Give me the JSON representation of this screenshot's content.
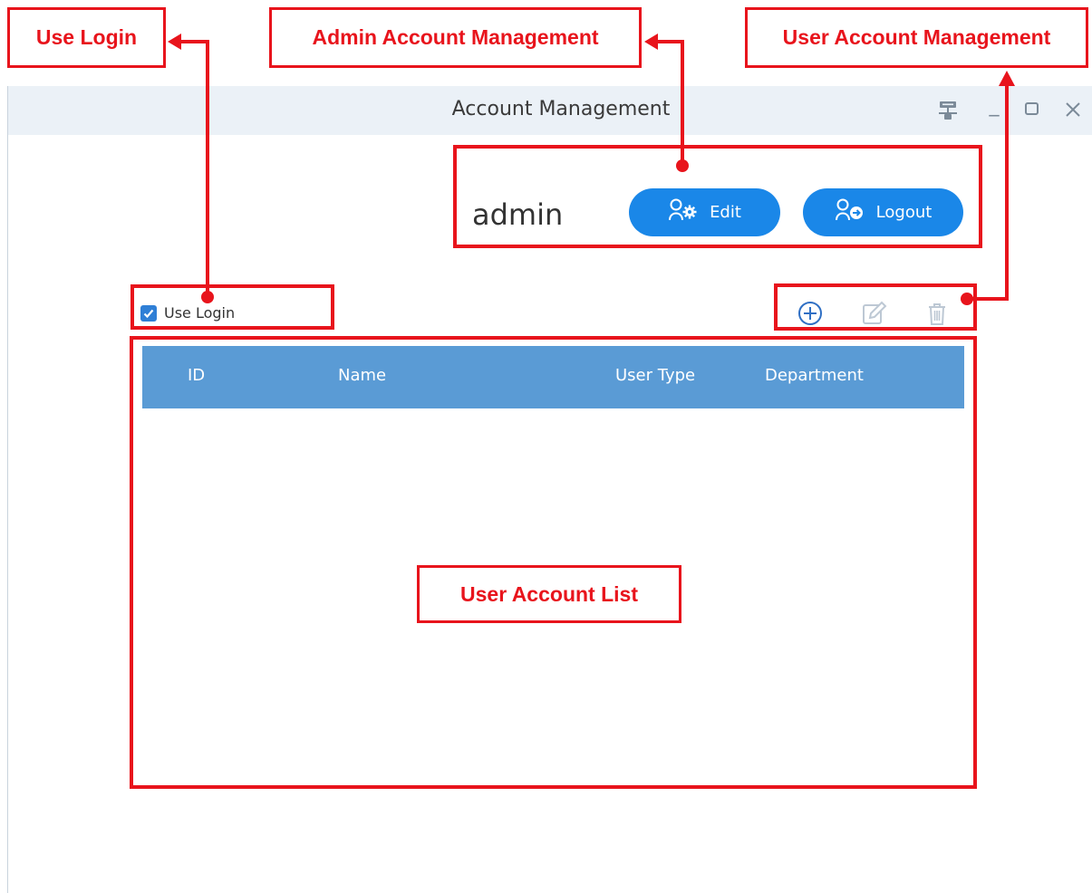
{
  "window": {
    "title": "Account Management",
    "minimize_glyph": "_",
    "controls": [
      "network-icon",
      "minimize-icon",
      "maximize-icon",
      "close-icon"
    ]
  },
  "admin": {
    "username": "admin",
    "edit_label": "Edit",
    "logout_label": "Logout",
    "edit_icon": "user-gear-icon",
    "logout_icon": "user-logout-icon"
  },
  "use_login": {
    "label": "Use Login",
    "checked": true
  },
  "toolbar": {
    "icons": [
      "add-circle-icon",
      "edit-pencil-icon",
      "trash-icon"
    ]
  },
  "table": {
    "columns": [
      "ID",
      "Name",
      "User Type",
      "Department"
    ],
    "rows": []
  },
  "annotations": {
    "use_login": "Use Login",
    "admin_account_management": "Admin Account Management",
    "user_account_management": "User Account Management",
    "user_account_list": "User Account List"
  },
  "colors": {
    "accent_blue": "#1a87e8",
    "table_header": "#5a9bd5",
    "title_bar": "#ebf1f7",
    "annotation_red": "#e8141c"
  }
}
